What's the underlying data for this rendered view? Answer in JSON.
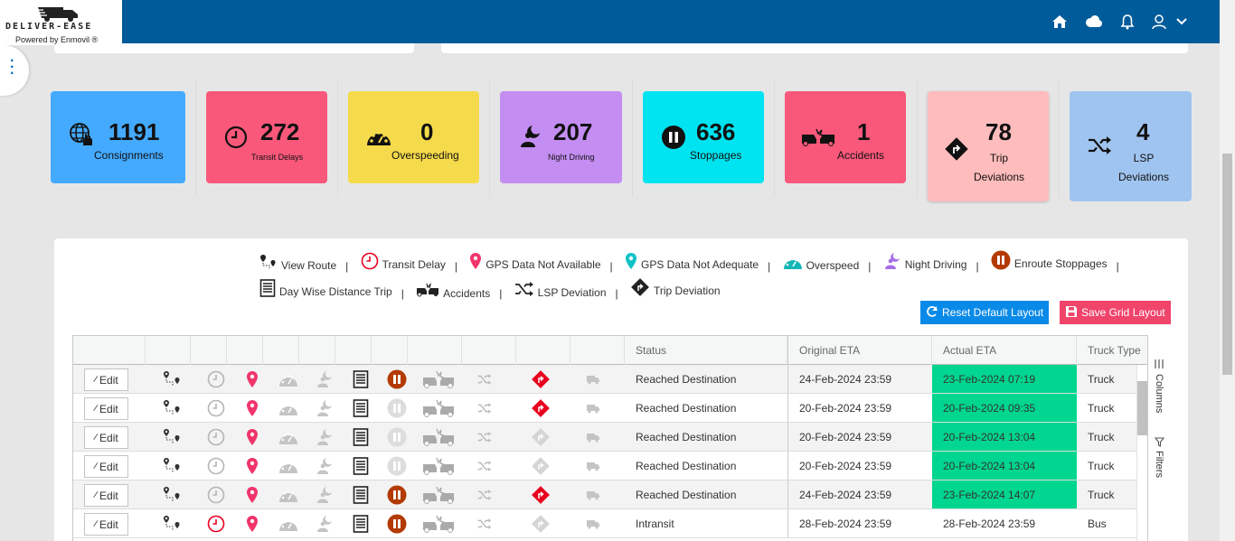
{
  "brand": {
    "name": "DELIVER-EASE",
    "tagline": "Powered by Enmovil ®"
  },
  "header": {
    "icons": [
      "home-icon",
      "cloud-icon",
      "bell-icon",
      "user-icon",
      "chevron-down-icon"
    ]
  },
  "cards": [
    {
      "value": "1191",
      "label": "Consignments",
      "color": "#44aaff",
      "icon": "globe-hand-icon"
    },
    {
      "value": "272",
      "label": "Transit Delays",
      "color": "#f9587a",
      "icon": "clock-icon"
    },
    {
      "value": "0",
      "label": "Overspeeding",
      "color": "#f5da4b",
      "icon": "speedometer-icon"
    },
    {
      "value": "207",
      "label": "Night Driving",
      "color": "#c48df2",
      "icon": "moon-person-icon"
    },
    {
      "value": "636",
      "label": "Stoppages",
      "color": "#00e3f0",
      "icon": "pause-icon"
    },
    {
      "value": "1",
      "label": "Accidents",
      "color": "#f9587a",
      "icon": "crash-icon"
    },
    {
      "value": "78",
      "label": "Trip Deviations",
      "color": "#ffbcbc",
      "icon": "diamond-turn-icon"
    },
    {
      "value": "4",
      "label": "LSP Deviations",
      "color": "#a0c4f0",
      "icon": "shuffle-icon"
    }
  ],
  "legend": [
    {
      "label": "View Route",
      "icon": "route-icon"
    },
    {
      "label": "Transit Delay",
      "icon": "clock-icon"
    },
    {
      "label": "GPS Data Not Available",
      "icon": "pin-red-icon"
    },
    {
      "label": "GPS Data Not Adequate",
      "icon": "pin-teal-icon"
    },
    {
      "label": "Overspeed",
      "icon": "speedometer-icon"
    },
    {
      "label": "Night Driving",
      "icon": "moon-person-icon"
    },
    {
      "label": "Enroute Stoppages",
      "icon": "pause-icon"
    },
    {
      "label": "Day Wise Distance Trip",
      "icon": "document-icon"
    },
    {
      "label": "Accidents",
      "icon": "crash-icon"
    },
    {
      "label": "LSP Deviation",
      "icon": "shuffle-icon"
    },
    {
      "label": "Trip Deviation",
      "icon": "diamond-turn-icon"
    }
  ],
  "buttons": {
    "reset": "Reset Default Layout",
    "save": "Save Grid Layout"
  },
  "grid": {
    "columns": {
      "status": "Status",
      "original_eta": "Original ETA",
      "actual_eta": "Actual ETA",
      "truck_type": "Truck Type"
    },
    "edit_label": "Edit",
    "side_tools": {
      "columns": "Columns",
      "filters": "Filters"
    },
    "rows": [
      {
        "status": "Reached Destination",
        "original_eta": "24-Feb-2024 23:59",
        "actual_eta": "23-Feb-2024 07:19",
        "truck_type": "Truck",
        "eta_early": true,
        "transit_delay": false,
        "stoppage": true,
        "trip_deviation": true
      },
      {
        "status": "Reached Destination",
        "original_eta": "20-Feb-2024 23:59",
        "actual_eta": "20-Feb-2024 09:35",
        "truck_type": "Truck",
        "eta_early": true,
        "transit_delay": false,
        "stoppage": false,
        "trip_deviation": true
      },
      {
        "status": "Reached Destination",
        "original_eta": "20-Feb-2024 23:59",
        "actual_eta": "20-Feb-2024 13:04",
        "truck_type": "Truck",
        "eta_early": true,
        "transit_delay": false,
        "stoppage": false,
        "trip_deviation": false
      },
      {
        "status": "Reached Destination",
        "original_eta": "20-Feb-2024 23:59",
        "actual_eta": "20-Feb-2024 13:04",
        "truck_type": "Truck",
        "eta_early": true,
        "transit_delay": false,
        "stoppage": false,
        "trip_deviation": false
      },
      {
        "status": "Reached Destination",
        "original_eta": "24-Feb-2024 23:59",
        "actual_eta": "23-Feb-2024 14:07",
        "truck_type": "Truck",
        "eta_early": true,
        "transit_delay": false,
        "stoppage": true,
        "trip_deviation": true
      },
      {
        "status": "Intransit",
        "original_eta": "28-Feb-2024 23:59",
        "actual_eta": "28-Feb-2024 23:59",
        "truck_type": "Bus",
        "eta_early": false,
        "transit_delay": true,
        "stoppage": true,
        "trip_deviation": false
      }
    ]
  }
}
